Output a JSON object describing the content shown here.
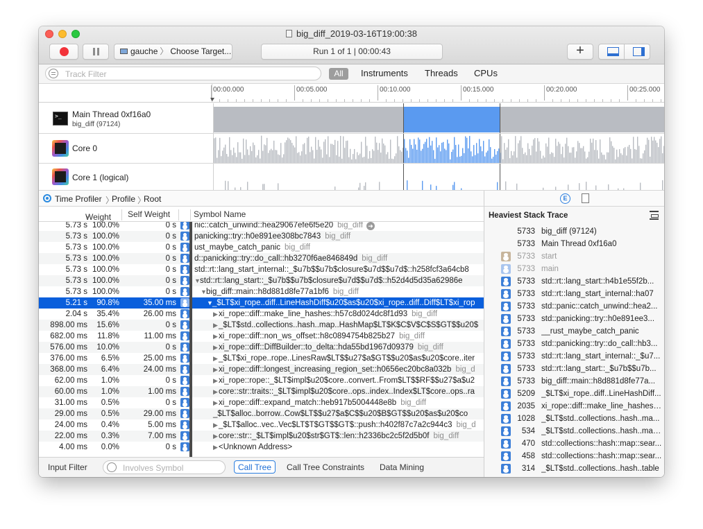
{
  "window": {
    "title": "big_diff_2019-03-16T19:00:38",
    "target_device": "gauche",
    "target_label": "Choose Target...",
    "run_info": "Run 1 of 1  |  00:00:43",
    "add_label": "+"
  },
  "filter_bar": {
    "placeholder": "Track Filter",
    "tabs": [
      "All",
      "Instruments",
      "Threads",
      "CPUs"
    ],
    "selected": "All"
  },
  "ruler": {
    "ticks": [
      "00:00.000",
      "00:05.000",
      "00:10.000",
      "00:15.000",
      "00:20.000",
      "00:25.000"
    ]
  },
  "tracks": [
    {
      "name": "Main Thread  0xf16a0",
      "sub": "big_diff (97124)",
      "icon": "terminal-icon"
    },
    {
      "name": "Core 0",
      "sub": "",
      "icon": "core-icon"
    },
    {
      "name": "Core 1 (logical)",
      "sub": "",
      "icon": "core-icon"
    }
  ],
  "breadcrumb": {
    "items": [
      "Time Profiler",
      "Profile",
      "Root"
    ]
  },
  "call_tree": {
    "columns": {
      "weight": "Weight",
      "self_weight": "Self Weight",
      "symbol": "Symbol Name"
    },
    "rows": [
      {
        "w": "5.73 s",
        "p": "100.0%",
        "s": "0 s",
        "sym": "nic::catch_unwind::hea29067efe6f5e20",
        "lib": "big_diff",
        "arrow": "",
        "goto": true,
        "indent": 0
      },
      {
        "w": "5.73 s",
        "p": "100.0%",
        "s": "0 s",
        "sym": "panicking::try::h0e891ee308bc7843",
        "lib": "big_diff",
        "arrow": "",
        "indent": 0
      },
      {
        "w": "5.73 s",
        "p": "100.0%",
        "s": "0 s",
        "sym": "ust_maybe_catch_panic",
        "lib": "big_diff",
        "arrow": "",
        "indent": 0
      },
      {
        "w": "5.73 s",
        "p": "100.0%",
        "s": "0 s",
        "sym": "d::panicking::try::do_call::hb3270f6ae846849d",
        "lib": "big_diff",
        "arrow": "",
        "indent": 0
      },
      {
        "w": "5.73 s",
        "p": "100.0%",
        "s": "0 s",
        "sym": "std::rt::lang_start_internal::_$u7b$$u7b$closure$u7d$$u7d$::h258fcf3a64cb8",
        "lib": "",
        "arrow": "",
        "indent": 0
      },
      {
        "w": "5.73 s",
        "p": "100.0%",
        "s": "0 s",
        "sym": "std::rt::lang_start::_$u7b$$u7b$closure$u7d$$u7d$::h52d4d5d35a62986e",
        "lib": "",
        "arrow": "▼",
        "indent": 0
      },
      {
        "w": "5.73 s",
        "p": "100.0%",
        "s": "0 s",
        "sym": "big_diff::main::h8d881d8fe77a1bf6",
        "lib": "big_diff",
        "arrow": "▼",
        "indent": 1
      },
      {
        "w": "5.21 s",
        "p": "90.8%",
        "s": "35.00 ms",
        "sym": "_$LT$xi_rope..diff..LineHashDiff$u20$as$u20$xi_rope..diff..Diff$LT$xi_rop",
        "lib": "",
        "arrow": "▼",
        "indent": 2,
        "selected": true
      },
      {
        "w": "2.04 s",
        "p": "35.4%",
        "s": "26.00 ms",
        "sym": "xi_rope::diff::make_line_hashes::h57c8d024dc8f1d93",
        "lib": "big_diff",
        "arrow": "▶",
        "indent": 3
      },
      {
        "w": "898.00 ms",
        "p": "15.6%",
        "s": "0 s",
        "sym": "_$LT$std..collections..hash..map..HashMap$LT$K$C$V$C$S$GT$$u20$",
        "lib": "",
        "arrow": "▶",
        "indent": 3
      },
      {
        "w": "682.00 ms",
        "p": "11.8%",
        "s": "11.00 ms",
        "sym": "xi_rope::diff::non_ws_offset::h8c0894754b825b27",
        "lib": "big_diff",
        "arrow": "▶",
        "indent": 3
      },
      {
        "w": "576.00 ms",
        "p": "10.0%",
        "s": "0 s",
        "sym": "xi_rope::diff::DiffBuilder::to_delta::hda55bd1967d09379",
        "lib": "big_diff",
        "arrow": "▶",
        "indent": 3
      },
      {
        "w": "376.00 ms",
        "p": "6.5%",
        "s": "25.00 ms",
        "sym": "_$LT$xi_rope..rope..LinesRaw$LT$$u27$a$GT$$u20$as$u20$core..iter",
        "lib": "",
        "arrow": "▶",
        "indent": 3
      },
      {
        "w": "368.00 ms",
        "p": "6.4%",
        "s": "24.00 ms",
        "sym": "xi_rope::diff::longest_increasing_region_set::h0656ec20bc8a032b",
        "lib": "big_d",
        "arrow": "▶",
        "indent": 3
      },
      {
        "w": "62.00 ms",
        "p": "1.0%",
        "s": "0 s",
        "sym": "xi_rope::rope::_$LT$impl$u20$core..convert..From$LT$$RF$$u27$a$u2",
        "lib": "",
        "arrow": "▶",
        "indent": 3
      },
      {
        "w": "60.00 ms",
        "p": "1.0%",
        "s": "1.00 ms",
        "sym": "core::str::traits::_$LT$impl$u20$core..ops..index..Index$LT$core..ops..ra",
        "lib": "",
        "arrow": "▶",
        "indent": 3
      },
      {
        "w": "31.00 ms",
        "p": "0.5%",
        "s": "0 s",
        "sym": "xi_rope::diff::expand_match::heb917b5004448e8b",
        "lib": "big_diff",
        "arrow": "▶",
        "indent": 3
      },
      {
        "w": "29.00 ms",
        "p": "0.5%",
        "s": "29.00 ms",
        "sym": "_$LT$alloc..borrow..Cow$LT$$u27$a$C$$u20$B$GT$$u20$as$u20$co",
        "lib": "",
        "arrow": "",
        "indent": 3
      },
      {
        "w": "24.00 ms",
        "p": "0.4%",
        "s": "5.00 ms",
        "sym": "_$LT$alloc..vec..Vec$LT$T$GT$$GT$::push::h402f87c7a2c944c3",
        "lib": "big_d",
        "arrow": "▶",
        "indent": 3
      },
      {
        "w": "22.00 ms",
        "p": "0.3%",
        "s": "7.00 ms",
        "sym": "core::str::_$LT$impl$u20$str$GT$::len::h2336bc2c5f2d5b0f",
        "lib": "big_diff",
        "arrow": "▶",
        "indent": 3
      },
      {
        "w": "4.00 ms",
        "p": "0.0%",
        "s": "0 s",
        "sym": "<Unknown Address>",
        "lib": "",
        "arrow": "▶",
        "indent": 3
      }
    ]
  },
  "input_bar": {
    "label": "Input Filter",
    "placeholder": "Involves Symbol",
    "tabs": [
      "Call Tree",
      "Call Tree Constraints",
      "Data Mining"
    ],
    "active": "Call Tree"
  },
  "heaviest_stack": {
    "title": "Heaviest Stack Trace",
    "rows": [
      {
        "count": "5733",
        "name": "big_diff (97124)",
        "icon": "none"
      },
      {
        "count": "5733",
        "name": "Main Thread  0xf16a0",
        "icon": "none"
      },
      {
        "count": "5733",
        "name": "start",
        "icon": "gear",
        "dim": true
      },
      {
        "count": "5733",
        "name": "main",
        "icon": "light",
        "dim": true
      },
      {
        "count": "5733",
        "name": "std::rt::lang_start::h4b1e55f2b...",
        "icon": "user"
      },
      {
        "count": "5733",
        "name": "std::rt::lang_start_internal::ha07",
        "icon": "user"
      },
      {
        "count": "5733",
        "name": "std::panic::catch_unwind::hea2...",
        "icon": "user"
      },
      {
        "count": "5733",
        "name": "std::panicking::try::h0e891ee3...",
        "icon": "user"
      },
      {
        "count": "5733",
        "name": "__rust_maybe_catch_panic",
        "icon": "user"
      },
      {
        "count": "5733",
        "name": "std::panicking::try::do_call::hb3...",
        "icon": "user"
      },
      {
        "count": "5733",
        "name": "std::rt::lang_start_internal::_$u7...",
        "icon": "user"
      },
      {
        "count": "5733",
        "name": "std::rt::lang_start::_$u7b$$u7b...",
        "icon": "user"
      },
      {
        "count": "5733",
        "name": "big_diff::main::h8d881d8fe77a...",
        "icon": "user"
      },
      {
        "count": "5209",
        "name": "_$LT$xi_rope..diff..LineHashDiff...",
        "icon": "user"
      },
      {
        "count": "2035",
        "name": "xi_rope::diff::make_line_hashes::...",
        "icon": "user"
      },
      {
        "count": "1028",
        "name": "_$LT$std..collections..hash..ma...",
        "icon": "user"
      },
      {
        "count": "534",
        "name": "_$LT$std..collections..hash..map...",
        "icon": "user"
      },
      {
        "count": "470",
        "name": "std::collections::hash::map::sear...",
        "icon": "user"
      },
      {
        "count": "458",
        "name": "std::collections::hash::map::sear...",
        "icon": "user"
      },
      {
        "count": "314",
        "name": "_$LT$std..collections..hash..table",
        "icon": "user"
      }
    ]
  },
  "colors": {
    "selection": "#0a5fdc",
    "graph_gray": "#b9bcc2",
    "graph_blue": "#5a9af0",
    "accent": "#2a7ee0"
  }
}
